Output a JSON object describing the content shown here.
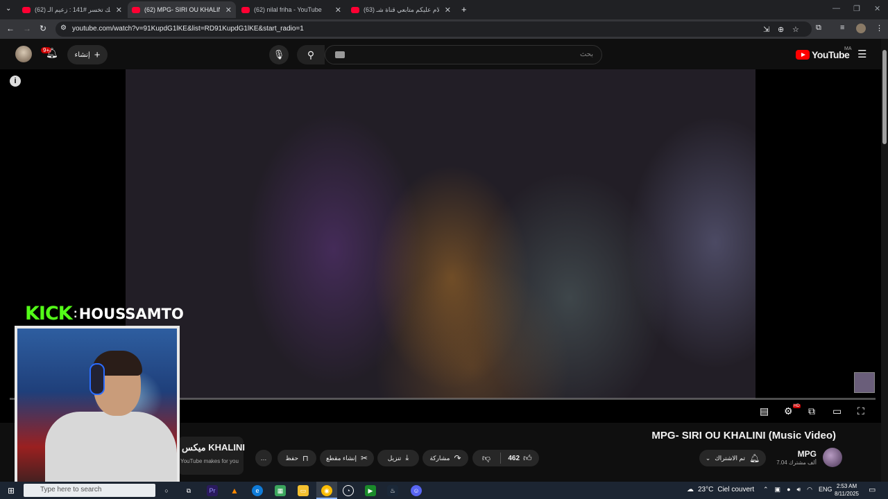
{
  "browser": {
    "tabs": [
      {
        "title": "(62) تضحك تخسر #141 : زعيم الـ"
      },
      {
        "title": "(62) MPG- SIRI OU KHALINI (M"
      },
      {
        "title": "(62) nilal friha - YouTube"
      },
      {
        "title": "(63) السلام عليكم متابعي قناة شـ"
      }
    ],
    "new_tab": "+",
    "url": "youtube.com/watch?v=91KupdG1lKE&list=RD91KupdG1lKE&start_radio=1"
  },
  "youtube": {
    "logo_text": "YouTube",
    "region": "MA",
    "search_placeholder": "بحث",
    "create_label": "إنشاء",
    "notification_count": "9+",
    "video_title": "MPG- SIRI OU KHALINI (Music Video)",
    "channel_name": "MPG",
    "subscribers": "7.04 ألف مشترك",
    "subscribed_label": "تم الاشتراك",
    "like_count": "462",
    "share_label": "مشاركة",
    "download_label": "تنزيل",
    "clip_label": "إنشاء مقطع",
    "save_label": "حفظ",
    "more_label": "…",
    "mix_title": "ميكس KHALINI",
    "mix_subtitle": "YouTube makes for you",
    "hd_badge": "HD"
  },
  "overlay": {
    "brand": "KICK",
    "separator": ":",
    "streamer": "HOUSSAMTO"
  },
  "taskbar": {
    "search_placeholder": "Type here to search",
    "temperature": "23°C",
    "weather": "Ciel couvert",
    "language": "ENG",
    "time": "2:53 AM",
    "date": "8/11/2025"
  },
  "colors": {
    "kick_green": "#53fc18",
    "youtube_red": "#ff0000",
    "page_bg": "#0f0f0f"
  },
  "icons": [
    "search-icon",
    "mic-icon",
    "bell-icon",
    "plus-icon",
    "menu-icon",
    "info-icon",
    "like-icon",
    "dislike-icon",
    "share-icon",
    "download-icon",
    "scissors-icon",
    "bookmark-icon",
    "more-icon",
    "subtitles-icon",
    "settings-icon",
    "miniplayer-icon",
    "theater-icon",
    "fullscreen-icon"
  ]
}
